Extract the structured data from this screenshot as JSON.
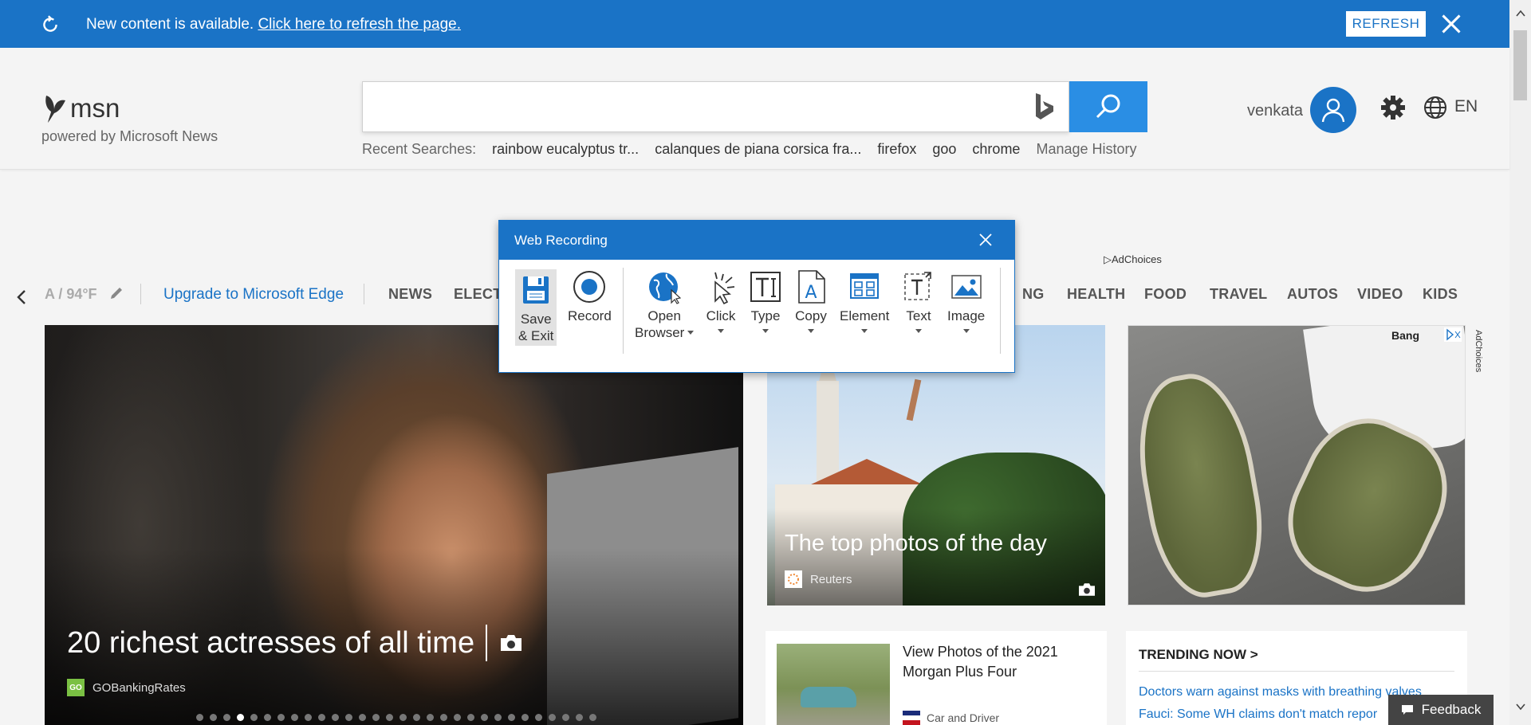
{
  "notification": {
    "message": "New content is available.",
    "link": "Click here to refresh the page.",
    "refresh_label": "REFRESH"
  },
  "header": {
    "logo_text": "msn",
    "powered_by": "powered by Microsoft News",
    "search_placeholder": "",
    "recent_label": "Recent Searches:",
    "recent_items": [
      "rainbow eucalyptus tr...",
      "calanques de piana corsica fra...",
      "firefox",
      "goo",
      "chrome"
    ],
    "manage_history": "Manage History",
    "username": "venkata",
    "language": "EN"
  },
  "nav": {
    "weather": "A / 94°F",
    "upgrade": "Upgrade to Microsoft Edge",
    "categories": [
      "NEWS",
      "ELECTI",
      "NG",
      "HEALTH",
      "FOOD",
      "TRAVEL",
      "AUTOS",
      "VIDEO",
      "KIDS"
    ],
    "adchoices": "AdChoices"
  },
  "hero": {
    "title": "20 richest actresses of all time",
    "source": "GOBankingRates",
    "source_badge": "GO",
    "slide_count": 30,
    "active_slide": 4
  },
  "tile2": {
    "title": "The top photos of the day",
    "source": "Reuters"
  },
  "ad": {
    "brand": "Bang",
    "adchoices": "AdChoices"
  },
  "card3": {
    "title": "View Photos of the 2021 Morgan Plus Four",
    "source": "Car and Driver"
  },
  "trending": {
    "heading": "TRENDING NOW >",
    "items": [
      "Doctors warn against masks with breathing valves",
      "Fauci: Some WH claims don't match repor"
    ]
  },
  "feedback_label": "Feedback",
  "dialog": {
    "title": "Web Recording",
    "tools": {
      "save_line1": "Save",
      "save_line2": "& Exit",
      "record": "Record",
      "open_line1": "Open",
      "open_line2": "Browser",
      "click": "Click",
      "type": "Type",
      "copy": "Copy",
      "element": "Element",
      "text": "Text",
      "image": "Image"
    }
  },
  "colors": {
    "msn_blue": "#1a73c6",
    "search_blue": "#2a8ee4",
    "link_blue": "#1a73c6"
  }
}
